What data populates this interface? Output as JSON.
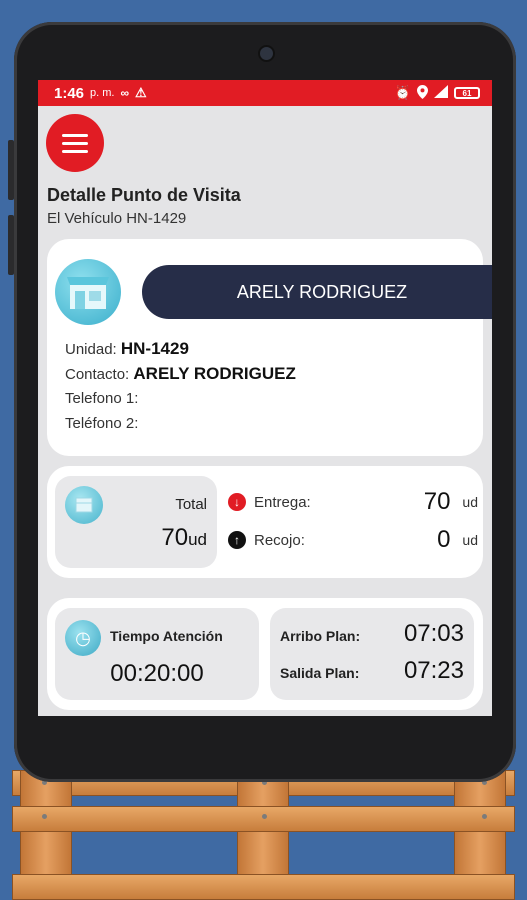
{
  "status_bar": {
    "time": "1:46",
    "ampm": "p. m.",
    "battery": "61"
  },
  "header": {
    "title": "Detalle Punto de Visita",
    "subtitle": "El Vehículo HN-1429"
  },
  "client": {
    "name": "ARELY RODRIGUEZ",
    "unidad_label": "Unidad:",
    "unidad_value": "HN-1429",
    "contacto_label": "Contacto:",
    "contacto_value": "ARELY RODRIGUEZ",
    "telefono1_label": "Telefono 1:",
    "telefono2_label": "Teléfono 2:"
  },
  "quantities": {
    "total_label": "Total",
    "total_value": "70",
    "total_unit": "ud",
    "entrega_label": "Entrega:",
    "entrega_value": "70",
    "entrega_unit": "ud",
    "recojo_label": "Recojo:",
    "recojo_value": "0",
    "recojo_unit": "ud"
  },
  "times": {
    "atencion_label": "Tiempo Atención",
    "atencion_value": "00:20:00",
    "arribo_label": "Arribo Plan:",
    "arribo_value": "07:03",
    "salida_label": "Salida Plan:",
    "salida_value": "07:23"
  },
  "colors": {
    "accent_red": "#e11c24",
    "navy": "#262d48",
    "background_blue": "#3f6aa3"
  },
  "icons": [
    "menu-icon",
    "store-icon",
    "box-icon",
    "arrow-down-icon",
    "arrow-up-icon",
    "clock-icon",
    "alarm-icon",
    "location-icon",
    "signal-icon",
    "battery-icon",
    "voicemail-icon",
    "warning-icon"
  ]
}
